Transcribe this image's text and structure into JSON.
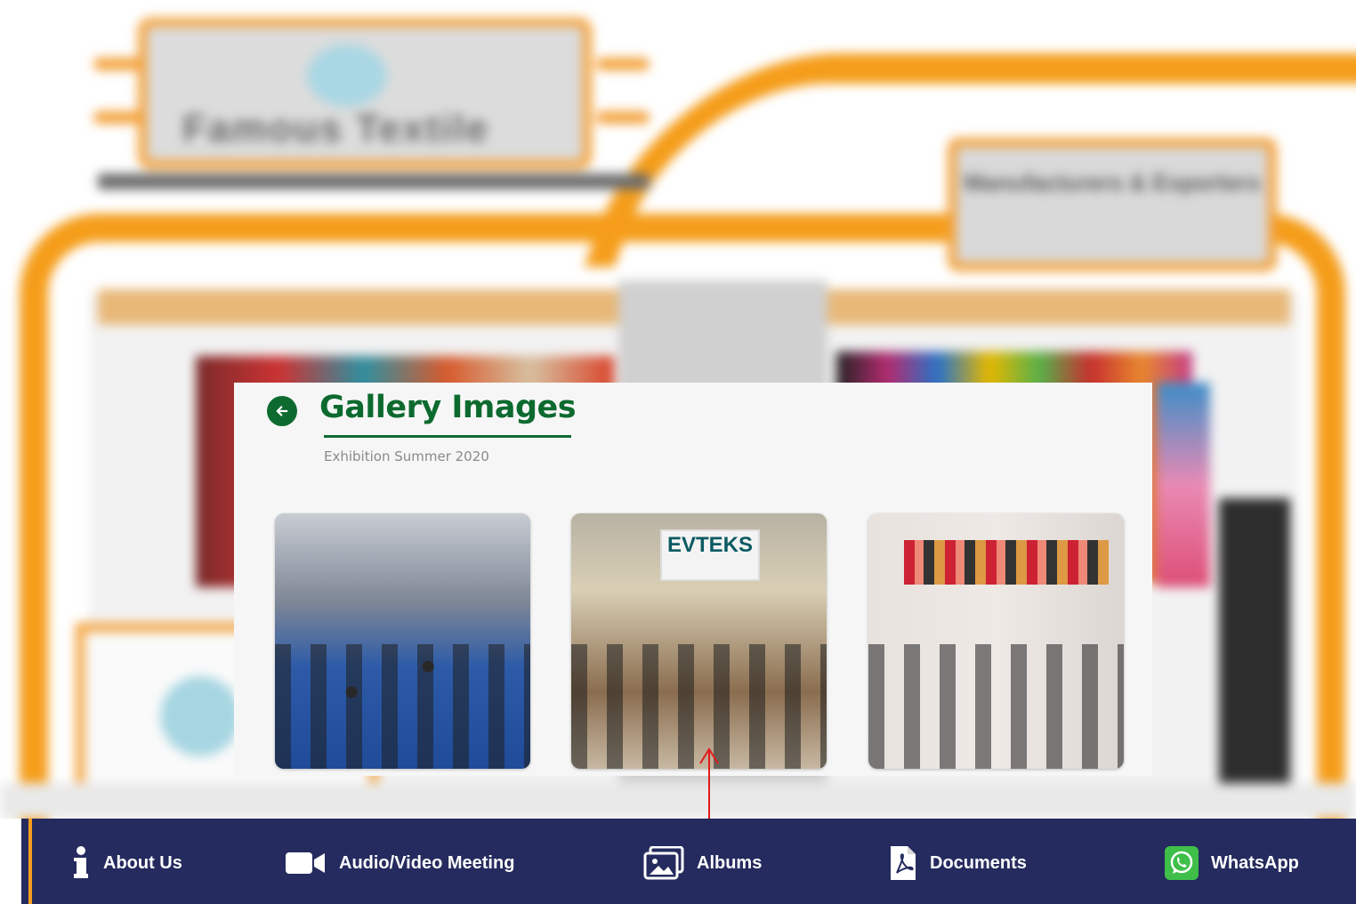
{
  "booth": {
    "left_sign_text": "Famous Textile",
    "right_sign_text": "Manufacturers & Exporters"
  },
  "gallery": {
    "title": "Gallery Images",
    "subtitle": "Exhibition Summer 2020",
    "thumbnail_2_sign": "EVTEKS"
  },
  "nav": {
    "about": "About Us",
    "meeting": "Audio/Video Meeting",
    "albums": "Albums",
    "documents": "Documents",
    "whatsapp": "WhatsApp"
  },
  "colors": {
    "nav_bg": "#252b5e",
    "accent_orange": "#f59d1a",
    "brand_green": "#0d6a2f",
    "annotation_red": "#e01b1b"
  },
  "icons": {
    "back": "arrow-left-icon",
    "about": "info-icon",
    "meeting": "video-camera-icon",
    "albums": "images-icon",
    "documents": "pdf-document-icon",
    "whatsapp": "whatsapp-icon"
  }
}
